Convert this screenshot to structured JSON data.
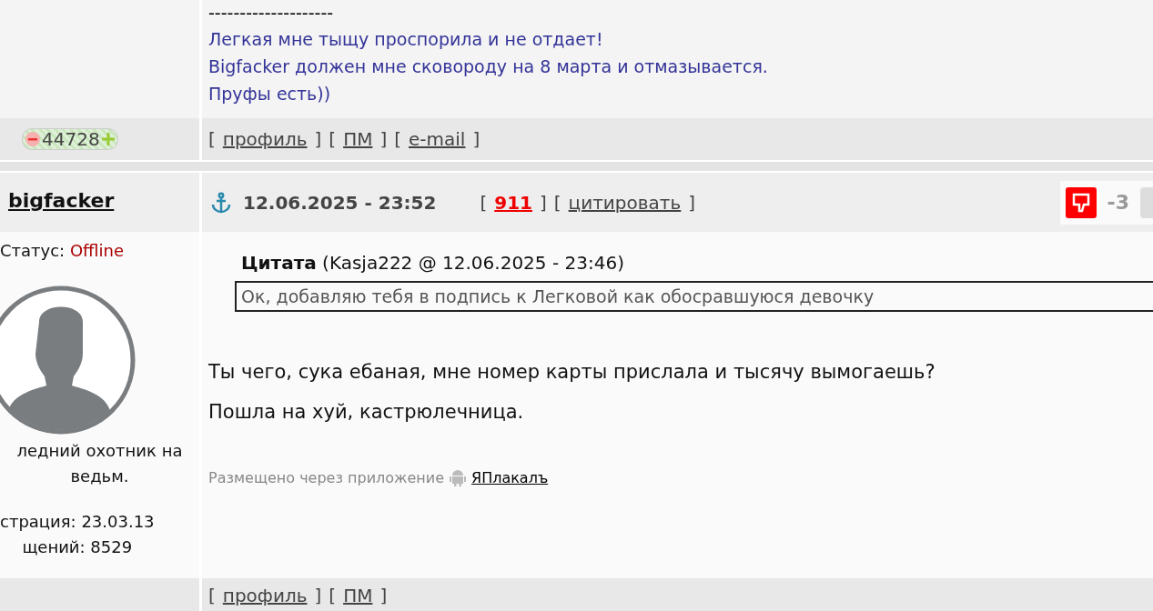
{
  "previous_post": {
    "signature_rule": "--------------------",
    "signature_lines": [
      "Легкая мне тыщу проспорила и не отдает!",
      "Bigfacker должен мне сковороду на 8 марта и отмазывается.",
      "Пруфы есть))"
    ],
    "reputation": "44728",
    "footer_links": [
      {
        "open": "[",
        "label": "профиль",
        "close": "]"
      },
      {
        "open": "[",
        "label": "ПМ",
        "close": "]"
      },
      {
        "open": "[",
        "label": "e-mail",
        "close": "]"
      }
    ]
  },
  "post": {
    "author": "bigfacker",
    "date": "12.06.2025 - 23:52",
    "actions": [
      {
        "open": "[",
        "label": "911",
        "close": "]",
        "kind": "number"
      },
      {
        "open": "[",
        "label": "цитировать",
        "close": "]",
        "kind": "link"
      }
    ],
    "rating": "-3",
    "status_label": "Статус:",
    "status": "Offline",
    "user_title": [
      "ледний охотник на",
      "ведьм."
    ],
    "user_info": [
      "страция: 23.03.13",
      "щений: 8529"
    ],
    "quote_header": "**Цитата** (Kasja222 @ 12.06.2025 - 23:46)",
    "quote_text": "Ок, добавляю тебя в подпись к Легковой как обосравшуюся девочку",
    "body_lines": [
      "Ты чего, сука ебаная, мне номер карты прислала и тысячу вымогаешь?",
      "Пошла на хуй, кастрюлечница."
    ],
    "via_text": "Размещено через приложение",
    "app_link": "ЯПлакалъ",
    "footer_links": [
      {
        "open": "[",
        "label": "профиль",
        "close": "]"
      },
      {
        "open": "[",
        "label": "ПМ",
        "close": "]"
      }
    ]
  }
}
